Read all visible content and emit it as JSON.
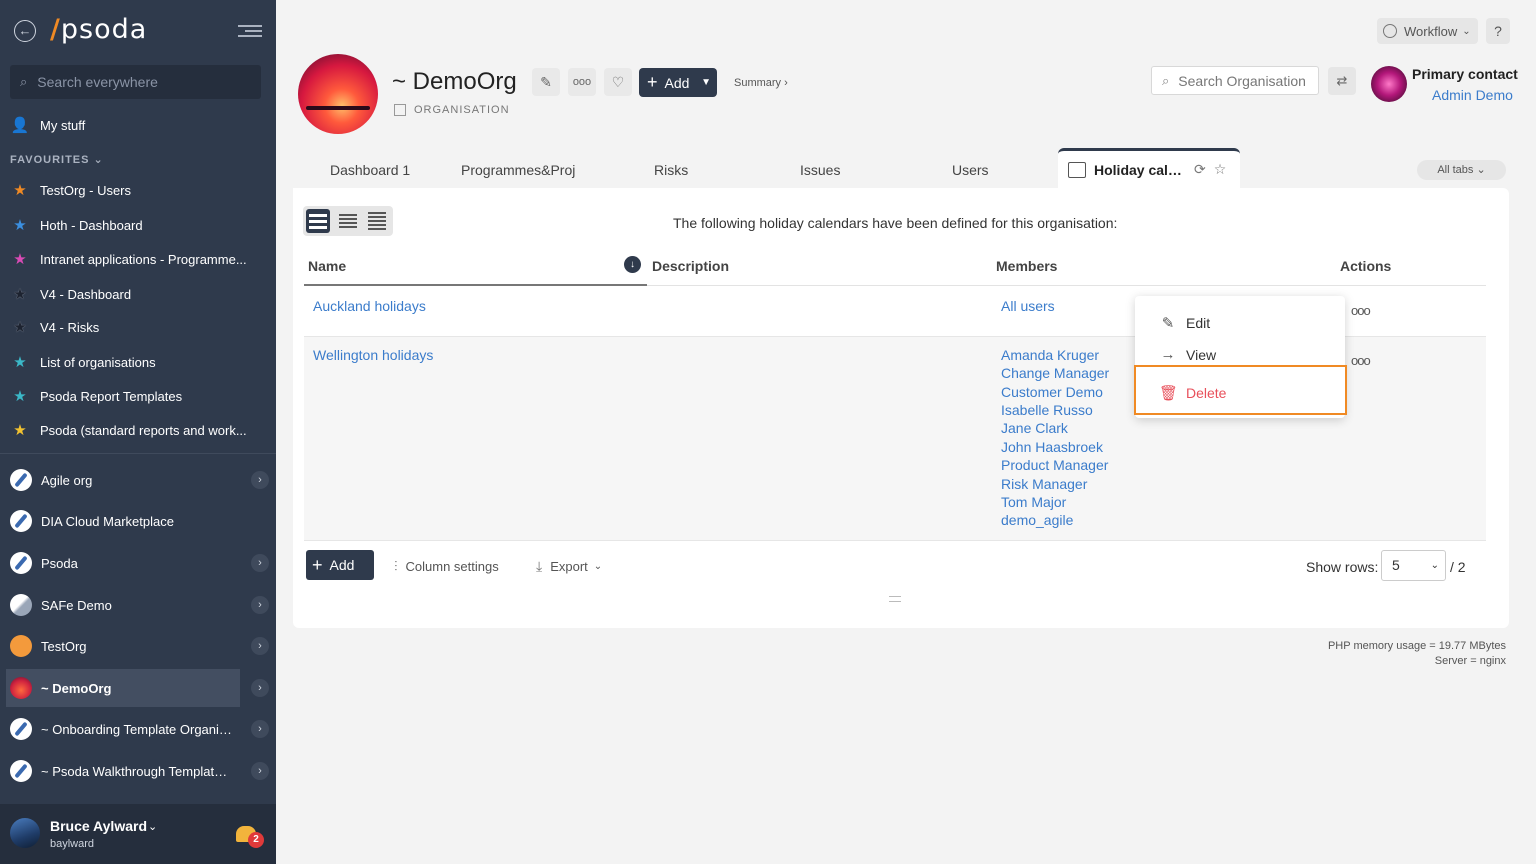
{
  "sidebar": {
    "logo": "psoda",
    "search_placeholder": "Search everywhere",
    "my_stuff": "My stuff",
    "favourites_header": "FAVOURITES",
    "favourites": [
      {
        "label": "TestOrg - Users",
        "color": "#f08a24"
      },
      {
        "label": "Hoth - Dashboard",
        "color": "#3b8fe0"
      },
      {
        "label": "Intranet applications - Programme...",
        "color": "#d94bb5"
      },
      {
        "label": "V4 - Dashboard",
        "color": "#1d2330"
      },
      {
        "label": "V4 - Risks",
        "color": "#1d2330"
      },
      {
        "label": "List of organisations",
        "color": "#3bb8c8"
      },
      {
        "label": "Psoda Report Templates",
        "color": "#3bb8c8"
      },
      {
        "label": "Psoda (standard reports and work...",
        "color": "#f2c230"
      }
    ],
    "orgs": [
      {
        "label": "Agile org",
        "icon": "compass-icon"
      },
      {
        "label": "DIA Cloud Marketplace",
        "icon": "compass-icon"
      },
      {
        "label": "Psoda",
        "icon": "compass-icon"
      },
      {
        "label": "SAFe Demo",
        "icon": "safe-logo-icon"
      },
      {
        "label": "TestOrg",
        "icon": "orange-circle-icon"
      },
      {
        "label": "~ DemoOrg",
        "icon": "sunset-icon"
      },
      {
        "label": "~ Onboarding Template Organisa...",
        "icon": "compass-icon"
      },
      {
        "label": "~ Psoda Walkthrough Template P...",
        "icon": "compass-icon"
      }
    ],
    "user": {
      "name": "Bruce Aylward",
      "login": "baylward",
      "notifications": "2"
    }
  },
  "header": {
    "org_title": "~ DemoOrg",
    "org_type": "ORGANISATION",
    "add_label": "Add",
    "summary_label": "Summary ›",
    "workflow_label": "Workflow",
    "help_label": "?",
    "search_placeholder": "Search Organisation",
    "contact_label": "Primary contact",
    "contact_name": "Admin Demo"
  },
  "tabs": {
    "items": [
      "Dashboard 1",
      "Programmes&Proj",
      "Risks",
      "Issues",
      "Users"
    ],
    "active": "Holiday cale...",
    "all_tabs": "All tabs"
  },
  "panel": {
    "description": "The following holiday calendars have been defined for this organisation:",
    "columns": {
      "name": "Name",
      "description": "Description",
      "members": "Members",
      "actions": "Actions"
    },
    "rows": [
      {
        "name": "Auckland holidays",
        "members": [
          "All users"
        ]
      },
      {
        "name": "Wellington holidays",
        "members": [
          "Amanda Kruger",
          "Change Manager",
          "Customer Demo",
          "Isabelle Russo",
          "Jane Clark",
          "John Haasbroek",
          "Product Manager",
          "Risk Manager",
          "Tom Major",
          "demo_agile"
        ]
      }
    ],
    "add_label": "Add",
    "column_settings": "Column settings",
    "export": "Export",
    "show_rows_label": "Show rows:",
    "rows_value": "5",
    "pages": "/ 2"
  },
  "menu": {
    "edit": "Edit",
    "view": "View",
    "delete": "Delete"
  },
  "footer": {
    "memory": "PHP memory usage = 19.77 MBytes",
    "server": "Server = nginx"
  },
  "colors": {
    "sidebar": "#2f3a4c",
    "accent": "#f08a24",
    "link": "#3b7ccb",
    "danger": "#e8505b"
  }
}
